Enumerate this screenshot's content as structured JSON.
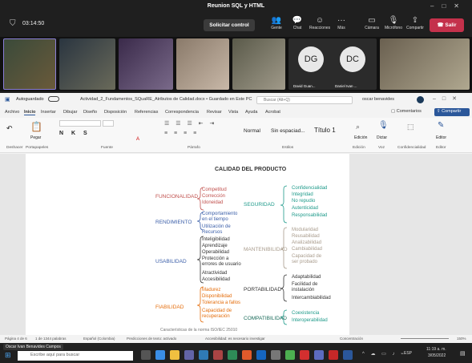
{
  "meeting": {
    "title": "Reunion SQL y HTML",
    "timer": "03:14:50",
    "control_label": "Solicitar control",
    "leave_label": "Salir",
    "toolbar": [
      {
        "label": "Gente",
        "icon": "people-icon"
      },
      {
        "label": "Chat",
        "icon": "chat-icon"
      },
      {
        "label": "Reacciones",
        "icon": "reactions-icon"
      },
      {
        "label": "Más",
        "icon": "more-icon"
      },
      {
        "label": "Cámara",
        "icon": "camera-icon"
      },
      {
        "label": "Micrófono",
        "icon": "mic-icon"
      },
      {
        "label": "Compartir",
        "icon": "share-icon"
      }
    ]
  },
  "participants": [
    {
      "initials": "DG",
      "name": "David Guan..."
    },
    {
      "initials": "DC",
      "name": "Daniel Ivan ..."
    }
  ],
  "word": {
    "autosave_label": "Autoguardado",
    "doc_title": "Actividad_2_Fundamentos_SQuaRE_Atributos de Calidad.docx • Guardado en Este PC",
    "search_placeholder": "Buscar (Alt+Q)",
    "user": "oscar benavides",
    "comments_label": "Comentarios",
    "share_label": "Compartir",
    "menu": [
      "Archivo",
      "Inicio",
      "Insertar",
      "Dibujar",
      "Diseño",
      "Disposición",
      "Referencias",
      "Correspondencia",
      "Revisar",
      "Vista",
      "Ayuda",
      "Acrobat"
    ],
    "groups": [
      "Deshacer",
      "Portapapeles",
      "Fuente",
      "Párrafo",
      "Estilos",
      "Edición",
      "Voz",
      "Confidencialidad",
      "Editor"
    ],
    "styles": [
      "Normal",
      "Sin espaciad...",
      "Título 1"
    ],
    "paste_label": "Pegar",
    "edit_label": "Edición",
    "dictate_label": "Dictar",
    "editor_label": "Editor"
  },
  "diagram": {
    "title": "CALIDAD DEL PRODUCTO",
    "funcionalidad": {
      "label": "FUNCIONALIDAD",
      "items": [
        "Competitud",
        "Corrección",
        "Idoneidad"
      ]
    },
    "rendimiento": {
      "label": "RENDIMIENTO",
      "items": [
        "Comportamiento en el tiempo",
        "Utilización de Recursos"
      ]
    },
    "usabilidad": {
      "label": "USABILIDAD",
      "items": [
        "Inteligibilidad",
        "Aprendizaje",
        "Operabilidad",
        "Protección a errores de usuario",
        "Atractividad",
        "Accesibilidad"
      ]
    },
    "fiabilidad": {
      "label": "FIABILIDAD",
      "items": [
        "Madurez",
        "Disponibilidad",
        "Tolerancia a fallos",
        "Capacidad de recuperación"
      ]
    },
    "seguridad": {
      "label": "SEGURIDAD",
      "items": [
        "Confidencialidad",
        "Integridad",
        "No repudio",
        "Autenticidad",
        "Responsabilidad"
      ]
    },
    "mantenibilidad": {
      "label": "MANTENIBILIDAD",
      "items": [
        "Modularidad",
        "Reusabilidad",
        "Analizabilidad",
        "Cambiabilidad",
        "Capacidad de ser probado"
      ]
    },
    "portabilidad": {
      "label": "PORTABILIDAD",
      "items": [
        "Adaptabilidad",
        "Facilidad de instalación",
        "Intercambiabilidad"
      ]
    },
    "compatibilidad": {
      "label": "COMPATIBILIDAD",
      "items": [
        "Coexistencia",
        "Interoperabilidad"
      ]
    },
    "caption": "Características de la norma ISO/IEC 25010"
  },
  "status": {
    "page": "Página 4 de 6",
    "words": "1 de 1344 palabras",
    "lang": "Español (Colombia)",
    "predict": "Predicciones de texto: activado",
    "access": "Accesibilidad: es necesario investigar",
    "focus": "Concentración",
    "zoom": "150%"
  },
  "taskbar": {
    "search_placeholder": "Escribe aquí para buscar",
    "presenter": "Oscar Ivan Benavides Campos",
    "time": "11:19 a. m.",
    "date": "3/05/2022",
    "lang": "ESP"
  }
}
